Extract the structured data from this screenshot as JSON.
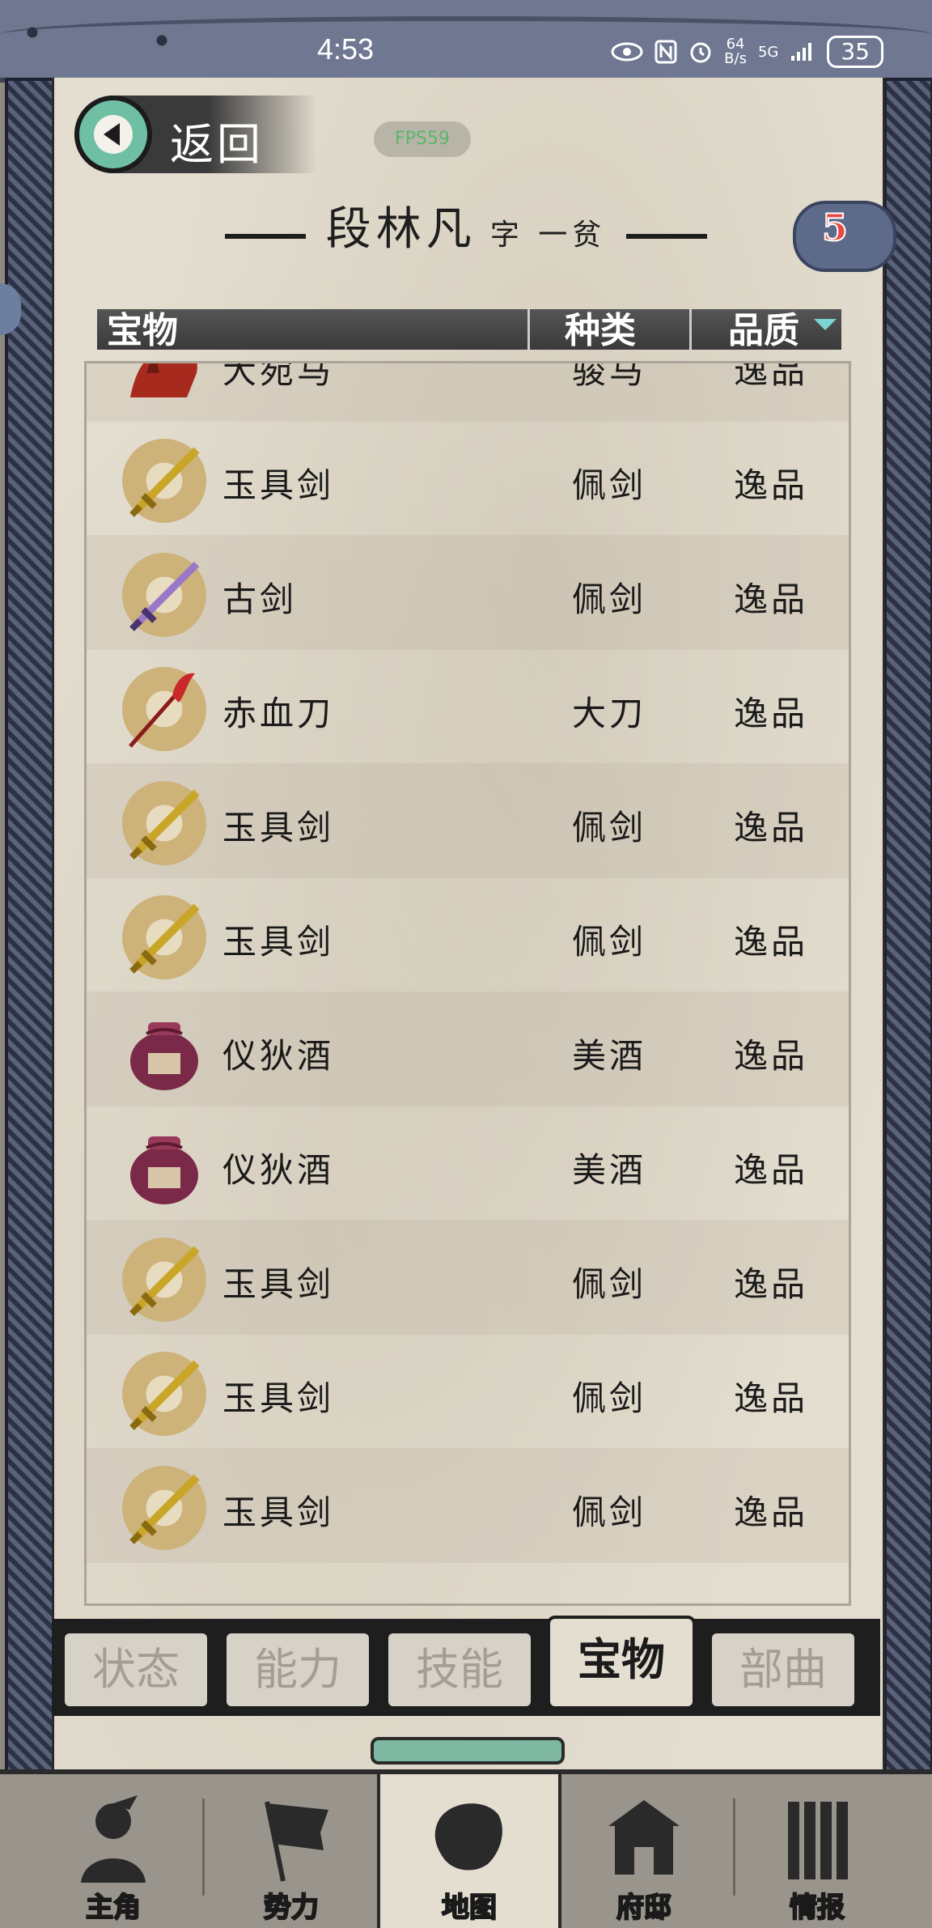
{
  "status_bar": {
    "time": "4:53",
    "net_speed_value": "64",
    "net_speed_unit": "B/s",
    "network": "5G",
    "battery": "35"
  },
  "header": {
    "back_label": "返回",
    "fps_label": "FPS59",
    "character_name": "段林凡",
    "courtesy_name": "字 一贫",
    "badge_count": "5"
  },
  "columns": {
    "item": "宝物",
    "kind": "种类",
    "quality": "品质"
  },
  "items": [
    {
      "name": "大宛马",
      "kind": "骏马",
      "quality": "逸品",
      "icon": "horse-icon"
    },
    {
      "name": "玉具剑",
      "kind": "佩剑",
      "quality": "逸品",
      "icon": "sword-icon"
    },
    {
      "name": "古剑",
      "kind": "佩剑",
      "quality": "逸品",
      "icon": "purple-sword-icon"
    },
    {
      "name": "赤血刀",
      "kind": "大刀",
      "quality": "逸品",
      "icon": "blade-icon"
    },
    {
      "name": "玉具剑",
      "kind": "佩剑",
      "quality": "逸品",
      "icon": "sword-icon"
    },
    {
      "name": "玉具剑",
      "kind": "佩剑",
      "quality": "逸品",
      "icon": "sword-icon"
    },
    {
      "name": "仪狄酒",
      "kind": "美酒",
      "quality": "逸品",
      "icon": "wine-jar-icon"
    },
    {
      "name": "仪狄酒",
      "kind": "美酒",
      "quality": "逸品",
      "icon": "wine-jar-icon"
    },
    {
      "name": "玉具剑",
      "kind": "佩剑",
      "quality": "逸品",
      "icon": "sword-icon"
    },
    {
      "name": "玉具剑",
      "kind": "佩剑",
      "quality": "逸品",
      "icon": "sword-icon"
    },
    {
      "name": "玉具剑",
      "kind": "佩剑",
      "quality": "逸品",
      "icon": "sword-icon"
    }
  ],
  "tabs": [
    {
      "label": "状态",
      "active": false
    },
    {
      "label": "能力",
      "active": false
    },
    {
      "label": "技能",
      "active": false
    },
    {
      "label": "宝物",
      "active": true
    },
    {
      "label": "部曲",
      "active": false
    }
  ],
  "bottom_nav": [
    {
      "label": "主角",
      "icon": "hero-icon",
      "active": false
    },
    {
      "label": "势力",
      "icon": "flag-icon",
      "active": false
    },
    {
      "label": "地图",
      "icon": "map-icon",
      "active": true
    },
    {
      "label": "府邸",
      "icon": "mansion-icon",
      "active": false
    },
    {
      "label": "情报",
      "icon": "scroll-icon",
      "active": false
    }
  ],
  "colors": {
    "paper": "#e4ded0",
    "frame": "#3e465c",
    "accent_green": "#6fbfa5",
    "badge_red": "#e84848"
  }
}
